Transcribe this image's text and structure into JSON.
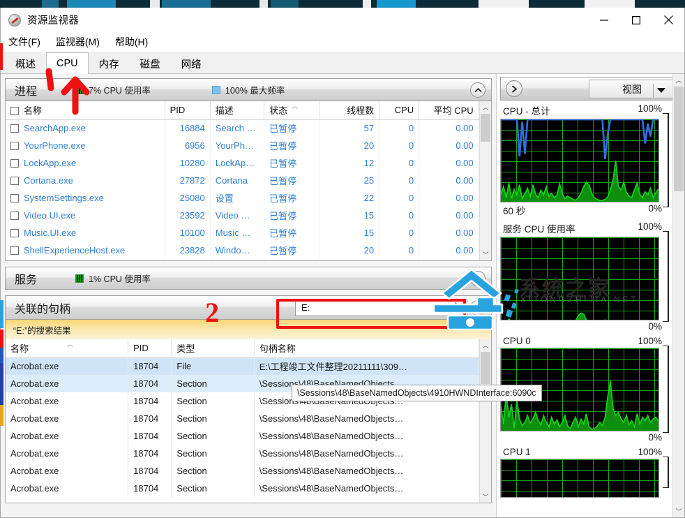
{
  "window": {
    "title": "资源监视器",
    "icon": "resource-monitor-icon",
    "buttons": {
      "minimize": "–",
      "maximize": "□",
      "close": "✕"
    }
  },
  "menu": [
    {
      "label": "文件(F)"
    },
    {
      "label": "监视器(M)"
    },
    {
      "label": "帮助(H)"
    }
  ],
  "tabs": [
    {
      "label": "概述",
      "active": false
    },
    {
      "label": "CPU",
      "active": true
    },
    {
      "label": "内存",
      "active": false
    },
    {
      "label": "磁盘",
      "active": false
    },
    {
      "label": "网络",
      "active": false
    }
  ],
  "processes_section": {
    "title": "进程",
    "cpu_usage": "7% CPU 使用率",
    "max_freq": "100% 最大频率",
    "collapse_icon": "chevron-up-icon",
    "columns": [
      "名称",
      "PID",
      "描述",
      "状态",
      "线程数",
      "CPU",
      "平均 CPU"
    ],
    "rows": [
      {
        "name": "SearchApp.exe",
        "pid": "16884",
        "desc": "Search …",
        "status": "已暂停",
        "threads": "57",
        "cpu": "0",
        "avg": "0.00"
      },
      {
        "name": "YourPhone.exe",
        "pid": "6956",
        "desc": "YourPh…",
        "status": "已暂停",
        "threads": "20",
        "cpu": "0",
        "avg": "0.00"
      },
      {
        "name": "LockApp.exe",
        "pid": "10280",
        "desc": "LockAp…",
        "status": "已暂停",
        "threads": "12",
        "cpu": "0",
        "avg": "0.00"
      },
      {
        "name": "Cortana.exe",
        "pid": "27872",
        "desc": "Cortana",
        "status": "已暂停",
        "threads": "25",
        "cpu": "0",
        "avg": "0.00"
      },
      {
        "name": "SystemSettings.exe",
        "pid": "25080",
        "desc": "设置",
        "status": "已暂停",
        "threads": "22",
        "cpu": "0",
        "avg": "0.00"
      },
      {
        "name": "Video.UI.exe",
        "pid": "23592",
        "desc": "Video …",
        "status": "已暂停",
        "threads": "15",
        "cpu": "0",
        "avg": "0.00"
      },
      {
        "name": "Music.UI.exe",
        "pid": "10100",
        "desc": "Music …",
        "status": "已暂停",
        "threads": "15",
        "cpu": "0",
        "avg": "0.00"
      },
      {
        "name": "ShellExperienceHost.exe",
        "pid": "23828",
        "desc": "Windo…",
        "status": "已暂停",
        "threads": "20",
        "cpu": "0",
        "avg": "0.00"
      }
    ]
  },
  "services_section": {
    "title": "服务",
    "cpu_usage": "1% CPU 使用率"
  },
  "handles_section": {
    "title": "关联的句柄",
    "search_value": "E:",
    "search_clear_icon": "clear-x-icon",
    "search_refresh_icon": "refresh-icon",
    "results_banner": "“E:”的搜索结果",
    "columns": [
      "名称",
      "PID",
      "类型",
      "句柄名称"
    ],
    "rows": [
      {
        "name": "Acrobat.exe",
        "pid": "18704",
        "type": "File",
        "handle": "E:\\工程竣工文件整理20211111\\309…"
      },
      {
        "name": "Acrobat.exe",
        "pid": "18704",
        "type": "Section",
        "handle": "\\Sessions\\48\\BaseNamedObjects…"
      },
      {
        "name": "Acrobat.exe",
        "pid": "18704",
        "type": "Section",
        "handle": "\\Sessions\\48\\BaseNamedObjects…"
      },
      {
        "name": "Acrobat.exe",
        "pid": "18704",
        "type": "Section",
        "handle": "\\Sessions\\48\\BaseNamedObjects…"
      },
      {
        "name": "Acrobat.exe",
        "pid": "18704",
        "type": "Section",
        "handle": "\\Sessions\\48\\BaseNamedObjects…"
      },
      {
        "name": "Acrobat.exe",
        "pid": "18704",
        "type": "Section",
        "handle": "\\Sessions\\48\\BaseNamedObjects…"
      },
      {
        "name": "Acrobat.exe",
        "pid": "18704",
        "type": "Section",
        "handle": "\\Sessions\\48\\BaseNamedObjects…"
      },
      {
        "name": "Acrobat.exe",
        "pid": "18704",
        "type": "Section",
        "handle": "\\Sessions\\48\\BaseNamedObjects…"
      }
    ]
  },
  "tooltip": {
    "text": "\\Sessions\\48\\BaseNamedObjects\\4910HWNDInterface:6090c"
  },
  "right_panel": {
    "expand_icon": "chevron-right-icon",
    "view_label": "视图",
    "view_caret_icon": "caret-down-icon",
    "graphs": [
      {
        "title": "CPU - 总计",
        "top": "100%",
        "bottom_left": "60 秒",
        "bottom_right": "0%"
      },
      {
        "title": "服务 CPU 使用率",
        "top": "100%",
        "bottom_left": "",
        "bottom_right": "0%"
      },
      {
        "title": "CPU 0",
        "top": "100%",
        "bottom_left": "",
        "bottom_right": "0%"
      },
      {
        "title": "CPU 1",
        "top": "100%",
        "bottom_left": "",
        "bottom_right": ""
      }
    ]
  },
  "annotations": [
    {
      "name": "arrow-to-cpu-tab",
      "kind": "arrow",
      "color": "#ee1111"
    },
    {
      "name": "step-2-marker",
      "kind": "text",
      "text": "2",
      "color": "#ee1111"
    },
    {
      "name": "search-box-highlight",
      "kind": "box",
      "color": "#ee1111"
    }
  ],
  "watermark": {
    "text": "系统之家",
    "subtext": "XITONGZHIJIA.NET",
    "logo": "xitongzhijia-logo"
  },
  "chart_data": [
    {
      "type": "line",
      "title": "CPU - 总计",
      "ylabel": "",
      "xlabel": "60 秒",
      "ylim": [
        0,
        100
      ],
      "ytick_labels": [
        "100%",
        "0%"
      ],
      "grid": true,
      "series": [
        {
          "name": "最大频率",
          "color": "#2f6fe0",
          "values": [
            100,
            100,
            100,
            100,
            100,
            100,
            100,
            57,
            97,
            60,
            100,
            100,
            100,
            100,
            100,
            100,
            100,
            100,
            100,
            100,
            100,
            100,
            100,
            100,
            100,
            100,
            100,
            100,
            100,
            100,
            100,
            100,
            100,
            100,
            100,
            100,
            100,
            100,
            100,
            54,
            83,
            100,
            100,
            100,
            100,
            100,
            100,
            100,
            100,
            100,
            100,
            100,
            100,
            100,
            72,
            95,
            80,
            100,
            100,
            100
          ]
        },
        {
          "name": "CPU 使用率",
          "color": "#17d417",
          "values": [
            12,
            22,
            9,
            26,
            8,
            19,
            12,
            24,
            8,
            14,
            20,
            10,
            24,
            13,
            9,
            18,
            12,
            22,
            10,
            14,
            9,
            12,
            25,
            14,
            8,
            11,
            9,
            7,
            6,
            9,
            14,
            22,
            27,
            24,
            14,
            9,
            7,
            6,
            6,
            7,
            10,
            18,
            30,
            52,
            22,
            18,
            27,
            15,
            11,
            9,
            18,
            26,
            13,
            9,
            16,
            12,
            20,
            9,
            15,
            19
          ]
        }
      ]
    },
    {
      "type": "line",
      "title": "服务 CPU 使用率",
      "ylim": [
        0,
        100
      ],
      "ytick_labels": [
        "100%",
        "0%"
      ],
      "grid": true,
      "series": [
        {
          "name": "服务 CPU",
          "color": "#17d417",
          "values": [
            1,
            1,
            2,
            5,
            3,
            1,
            1,
            4,
            2,
            1,
            1,
            1,
            2,
            1,
            1,
            1,
            1,
            1,
            1,
            2,
            1,
            1,
            1,
            1,
            1,
            1,
            1,
            2,
            3,
            9,
            12,
            11,
            4,
            1,
            1,
            1,
            1,
            1,
            2,
            4,
            3,
            1,
            1,
            1,
            1,
            1,
            1,
            1,
            1,
            1,
            1,
            1,
            1,
            1,
            1,
            2,
            3,
            2,
            1,
            1
          ]
        }
      ]
    },
    {
      "type": "line",
      "title": "CPU 0",
      "ylim": [
        0,
        100
      ],
      "ytick_labels": [
        "100%",
        "0%"
      ],
      "grid": true,
      "series": [
        {
          "name": "CPU 0",
          "color": "#17d417",
          "values": [
            34,
            12,
            48,
            20,
            35,
            7,
            40,
            18,
            10,
            14,
            22,
            13,
            18,
            26,
            16,
            11,
            22,
            14,
            9,
            20,
            12,
            17,
            9,
            14,
            22,
            10,
            7,
            14,
            20,
            9,
            18,
            12,
            24,
            9,
            6,
            7,
            9,
            14,
            10,
            20,
            44,
            62,
            30,
            22,
            26,
            18,
            14,
            22,
            11,
            16,
            9,
            24,
            12,
            20,
            16,
            22,
            14,
            18,
            20,
            16
          ]
        }
      ]
    },
    {
      "type": "line",
      "title": "CPU 1",
      "ylim": [
        0,
        100
      ],
      "ytick_labels": [
        "100%"
      ],
      "grid": true,
      "series": [
        {
          "name": "CPU 1",
          "color": "#17d417",
          "values": []
        }
      ]
    }
  ]
}
